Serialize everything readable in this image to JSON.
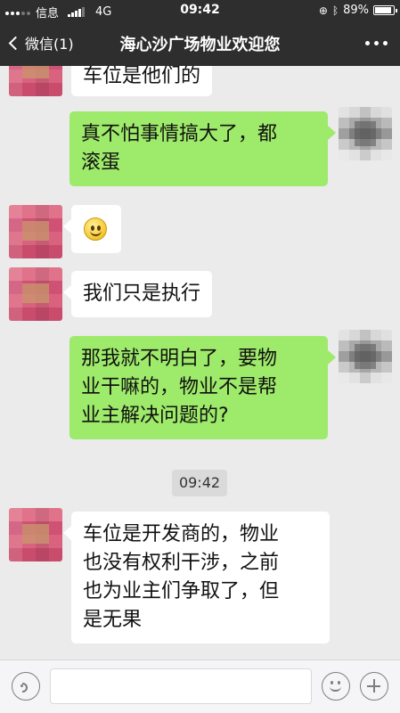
{
  "status_bar": {
    "carrier": "信息",
    "network": "4G",
    "time": "09:42",
    "battery_percent": "89%",
    "battery_level": 0.89,
    "icons": [
      "orientation-lock-icon",
      "bluetooth-icon",
      "battery-icon"
    ]
  },
  "nav": {
    "back_label": "微信(1)",
    "title": "海心沙广场物业欢迎您",
    "more_icon": "more-icon"
  },
  "messages": [
    {
      "side": "left",
      "text": "车位是他们的"
    },
    {
      "side": "right",
      "text": "真不怕事情搞大了，都\n滚蛋"
    },
    {
      "side": "left",
      "type": "emoji",
      "emoji": "smiley-icon"
    },
    {
      "side": "left",
      "text": "我们只是执行"
    },
    {
      "side": "right",
      "text": "那我就不明白了，要物\n业干嘛的，物业不是帮\n业主解决问题的?"
    },
    {
      "side": "left",
      "text": "车位是开发商的，物业\n也没有权利干涉，之前\n也为业主们争取了，但\n是无果"
    }
  ],
  "timestamp": "09:42",
  "input_bar": {
    "voice_icon": "voice-icon",
    "emoji_icon": "emoji-icon",
    "plus_icon": "plus-icon"
  },
  "colors": {
    "nav_bg": "#2e2e2e",
    "chat_bg": "#ebebeb",
    "right_bubble": "#9eea6a",
    "left_bubble": "#ffffff"
  }
}
